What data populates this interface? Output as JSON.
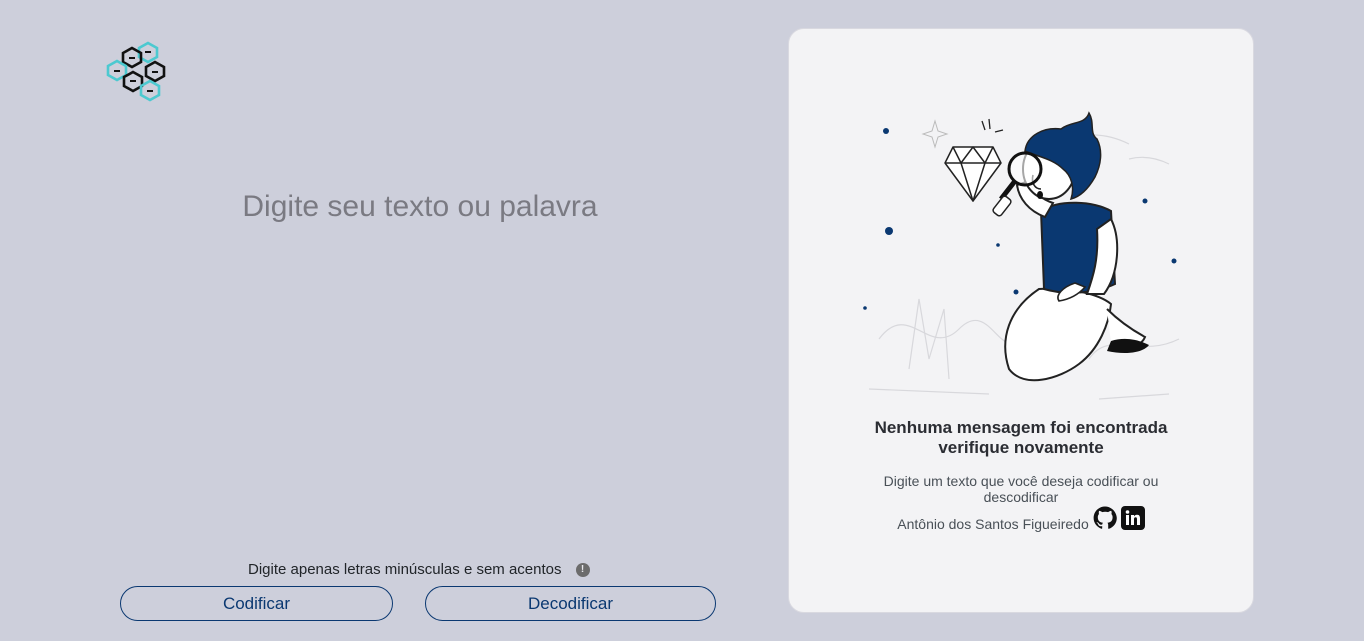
{
  "logo": {
    "icon": "hexagon-logo-icon"
  },
  "input": {
    "placeholder": "Digite seu texto ou palavra",
    "value": ""
  },
  "hint": {
    "text": "Digite apenas letras minúsculas e sem acentos",
    "icon": "exclamation-icon"
  },
  "buttons": {
    "encode": "Codificar",
    "decode": "Decodificar"
  },
  "output": {
    "title": "Nenhuma mensagem foi encontrada verifique novamente",
    "text": "Digite um texto que você deseja codificar ou descodificar",
    "author": "Antônio dos Santos Figueiredo",
    "social_icons": [
      "github-icon",
      "linkedin-icon"
    ]
  },
  "colors": {
    "background": "#cdcfdb",
    "accent": "#0a3871",
    "logo_cyan": "#4cc9d0",
    "card": "#f3f3f5"
  }
}
